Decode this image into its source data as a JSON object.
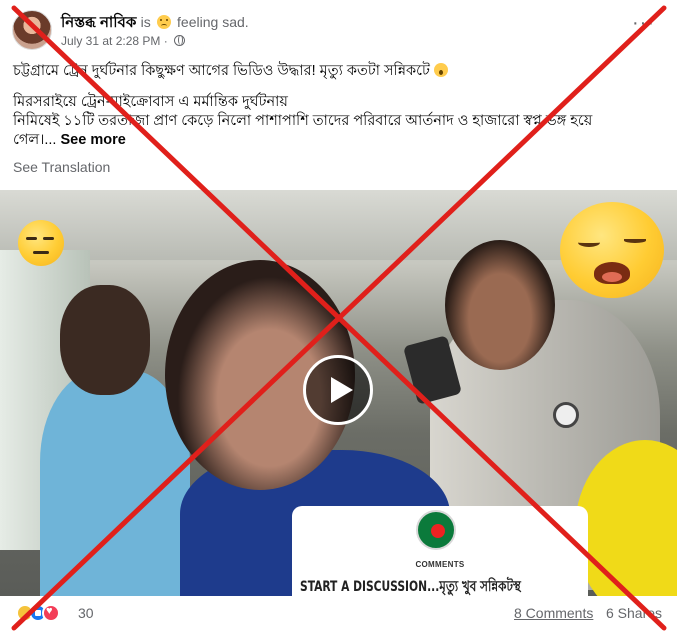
{
  "post": {
    "author": "নিস্তব্ধ নাবিক",
    "is_text": "is",
    "feeling_text": "feeling sad.",
    "timestamp": "July 31 at 2:28 PM",
    "privacy_separator": "·",
    "privacy_icon": "globe-icon",
    "more_icon": "more-options-icon",
    "more_label": "···",
    "text_line1": "চট্টগ্রামে ট্রেন দুর্ঘটনার কিছুক্ষণ আগের ভিডিও উদ্ধার! মৃত্যু কতটা সন্নিকটে",
    "text_line2": "মিরসরাইয়ে ট্রেন-মাইক্রোবাস এ মর্মান্তিক দুর্ঘটনায়",
    "text_line3": "নিমিষেই ১১টি তরতাজা প্রাণ কেড়ে নিলো পাশাপাশি তাদের পরিবারে আর্তনাদ ও হাজারো স্বপ্ন ভঙ্গ হয়ে",
    "text_line4": "গেল।...",
    "see_more": "See more",
    "see_translation": "See Translation"
  },
  "video": {
    "play_icon": "play-icon",
    "card_label": "COMMENTS",
    "card_title": "START A DISCUSSION...মৃত্যু খুব সন্নিকটস্থ"
  },
  "footer": {
    "reaction_icons": [
      "sad-reaction-icon",
      "like-reaction-icon",
      "love-reaction-icon"
    ],
    "reaction_count": "30",
    "comments": "8 Comments",
    "shares": "6 Shares"
  },
  "overlay": {
    "cross_color": "#e0201b"
  }
}
